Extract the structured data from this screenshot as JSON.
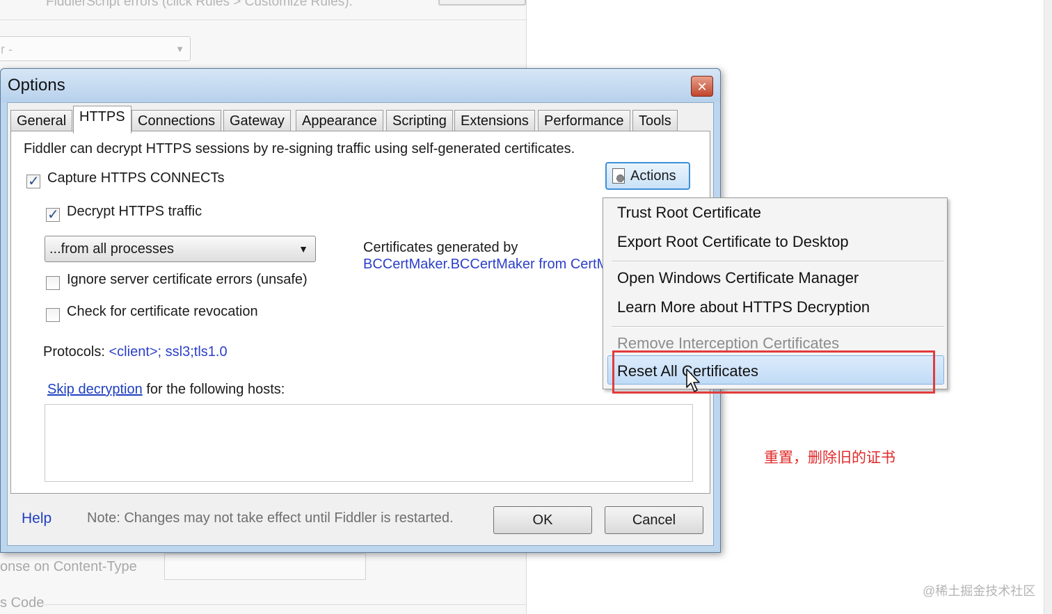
{
  "background": {
    "top_text": "FiddlerScript errors (click Rules > Customize Rules).",
    "select_value": "r -",
    "label_content_type": "onse on Content-Type",
    "label_code": "s Code"
  },
  "dialog": {
    "title": "Options",
    "close_glyph": "✕",
    "tabs": [
      "General",
      "HTTPS",
      "Connections",
      "Gateway",
      "Appearance",
      "Scripting",
      "Extensions",
      "Performance",
      "Tools"
    ],
    "active_tab": "HTTPS",
    "https": {
      "intro": "Fiddler can decrypt HTTPS sessions by re-signing traffic using self-generated certificates.",
      "capture_label": "Capture HTTPS CONNECTs",
      "capture_checked": true,
      "decrypt_label": "Decrypt HTTPS traffic",
      "decrypt_checked": true,
      "process_filter": "...from all processes",
      "ignore_errors_label": "Ignore server certificate errors (unsafe)",
      "ignore_errors_checked": false,
      "revocation_label": "Check for certificate revocation",
      "revocation_checked": false,
      "cert_generated_by": "Certificates generated by",
      "cert_maker": "BCCertMaker.BCCertMaker from CertMaker.dll",
      "protocols_label": "Protocols:",
      "protocols_value": "<client>; ssl3;tls1.0",
      "skip_link": "Skip decryption",
      "skip_text": "for the following hosts:",
      "hosts_value": "",
      "actions_label": "Actions"
    },
    "footer": {
      "help": "Help",
      "note": "Note: Changes may not take effect until Fiddler is restarted.",
      "ok": "OK",
      "cancel": "Cancel"
    }
  },
  "context_menu": {
    "trust_root": "Trust Root Certificate",
    "export_root": "Export Root Certificate to Desktop",
    "open_manager": "Open Windows Certificate Manager",
    "learn_more": "Learn More about HTTPS Decryption",
    "remove_interception": "Remove Interception Certificates",
    "reset_all": "Reset All Certificates",
    "highlighted": "Reset All Certificates"
  },
  "annotation": "重置，删除旧的证书",
  "watermark": "@稀土掘金技术社区",
  "colors": {
    "link": "#1e3fc0",
    "annotation": "#e02a2a",
    "highlight": "#c1dbf6",
    "focus_border": "#3c8fd8"
  }
}
